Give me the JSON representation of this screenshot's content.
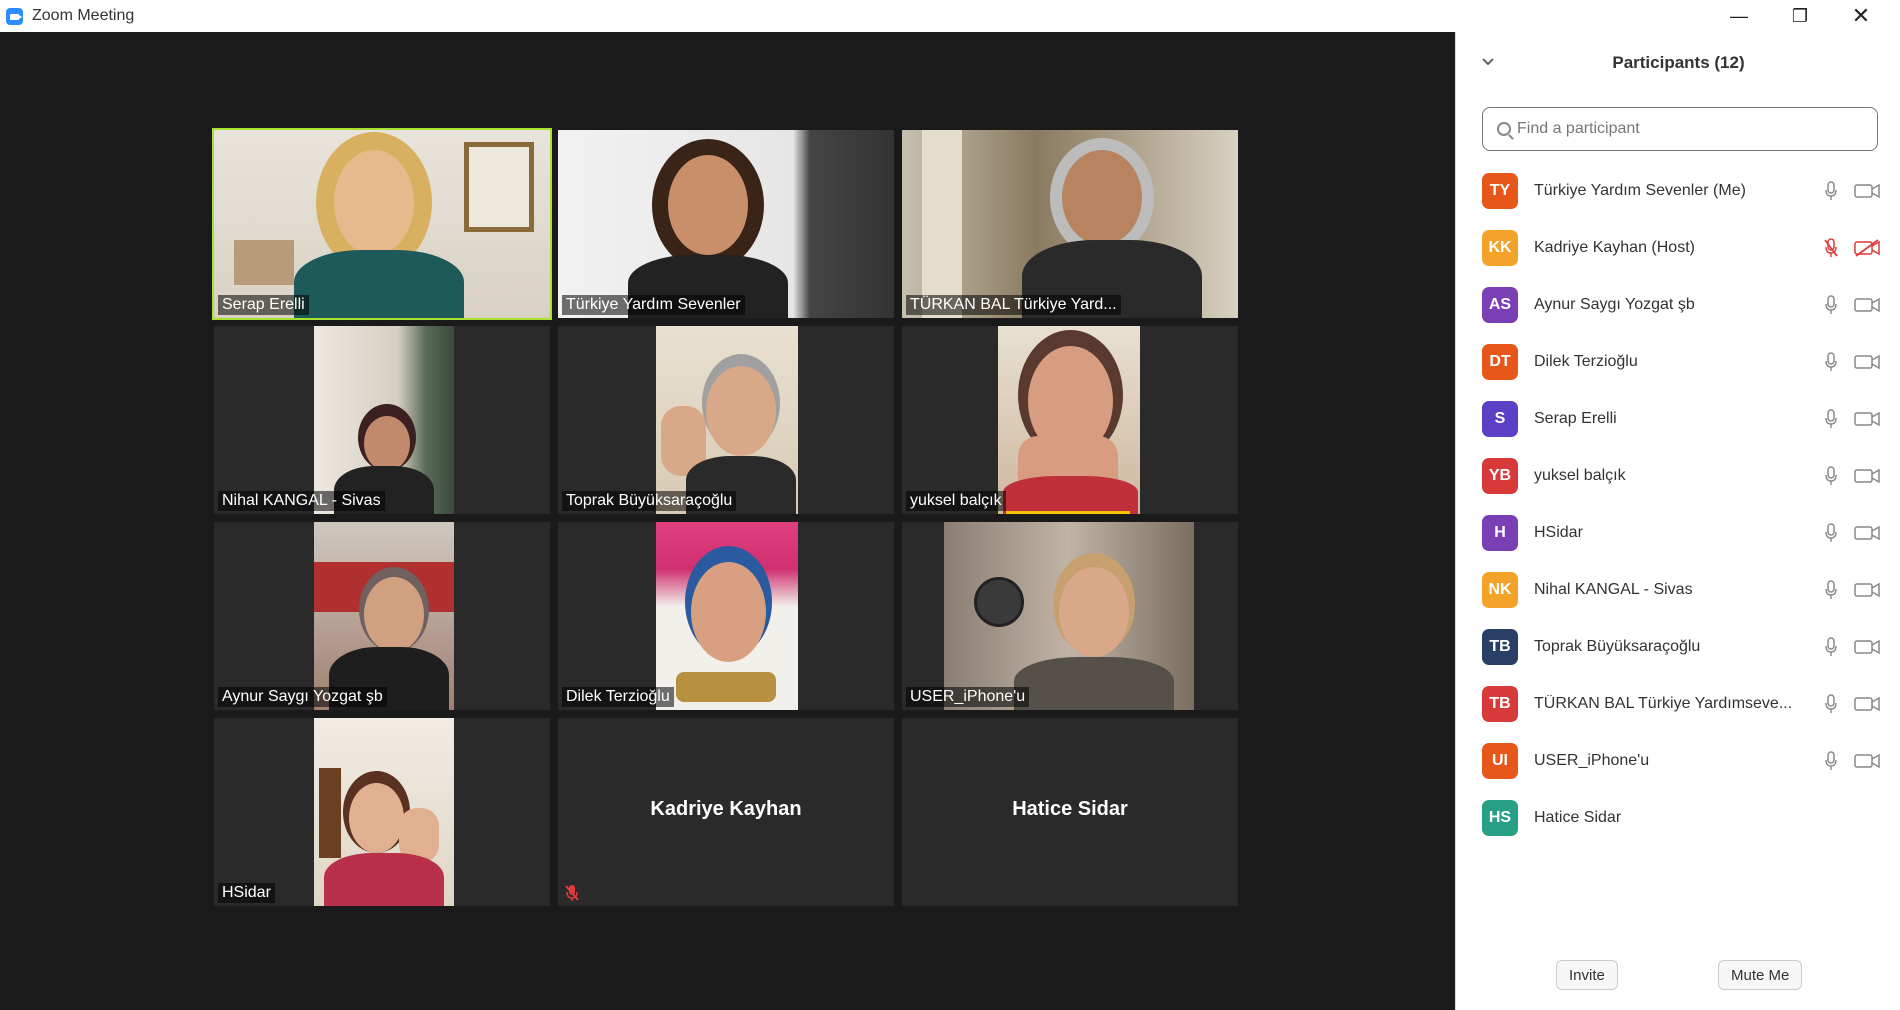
{
  "window": {
    "title": "Zoom Meeting",
    "minimize": "—",
    "maximize": "❐",
    "close": "✕"
  },
  "tiles": [
    {
      "name": "Serap Erelli",
      "active": true
    },
    {
      "name": "Türkiye Yardım Sevenler"
    },
    {
      "name": "TÜRKAN BAL Türkiye Yard..."
    },
    {
      "name": "Nihal KANGAL - Sivas"
    },
    {
      "name": "Toprak Büyüksaraçoğlu"
    },
    {
      "name": "yuksel balçık"
    },
    {
      "name": "Aynur Saygı Yozgat şb"
    },
    {
      "name": "Dilek Terzioğlu"
    },
    {
      "name": "USER_iPhone'u"
    },
    {
      "name": "HSidar"
    },
    {
      "center_name": "Kadriye Kayhan",
      "muted": true
    },
    {
      "center_name": "Hatice Sidar"
    }
  ],
  "participants_panel": {
    "title": "Participants (12)",
    "search_placeholder": "Find a participant",
    "participants": [
      {
        "initials": "TY",
        "name": "Türkiye Yardım Sevenler (Me)",
        "color": "#e8571a",
        "mic": "on",
        "video": "on"
      },
      {
        "initials": "KK",
        "name": "Kadriye Kayhan (Host)",
        "color": "#f4a32a",
        "mic": "muted",
        "video": "off"
      },
      {
        "initials": "AS",
        "name": "Aynur Saygı Yozgat şb",
        "color": "#7b3fb5",
        "mic": "on",
        "video": "on"
      },
      {
        "initials": "DT",
        "name": "Dilek Terzioğlu",
        "color": "#e8571a",
        "mic": "on",
        "video": "on"
      },
      {
        "initials": "S",
        "name": "Serap Erelli",
        "color": "#5b3fc4",
        "mic": "on",
        "video": "on"
      },
      {
        "initials": "YB",
        "name": "yuksel balçık",
        "color": "#d83a3a",
        "mic": "on",
        "video": "on"
      },
      {
        "initials": "H",
        "name": "HSidar",
        "color": "#7b3fb5",
        "mic": "on",
        "video": "on"
      },
      {
        "initials": "NK",
        "name": "Nihal KANGAL - Sivas",
        "color": "#f4a32a",
        "mic": "on",
        "video": "on"
      },
      {
        "initials": "TB",
        "name": "Toprak Büyüksaraçoğlu",
        "color": "#2a3f66",
        "mic": "on",
        "video": "on"
      },
      {
        "initials": "TB",
        "name": "TÜRKAN BAL Türkiye Yardımseve...",
        "color": "#d83a3a",
        "mic": "on",
        "video": "on"
      },
      {
        "initials": "UI",
        "name": "USER_iPhone'u",
        "color": "#e8571a",
        "mic": "on",
        "video": "on"
      },
      {
        "initials": "HS",
        "name": "Hatice Sidar",
        "color": "#27a085",
        "mic": "none",
        "video": "none"
      }
    ],
    "invite_label": "Invite",
    "mute_me_label": "Mute Me"
  }
}
